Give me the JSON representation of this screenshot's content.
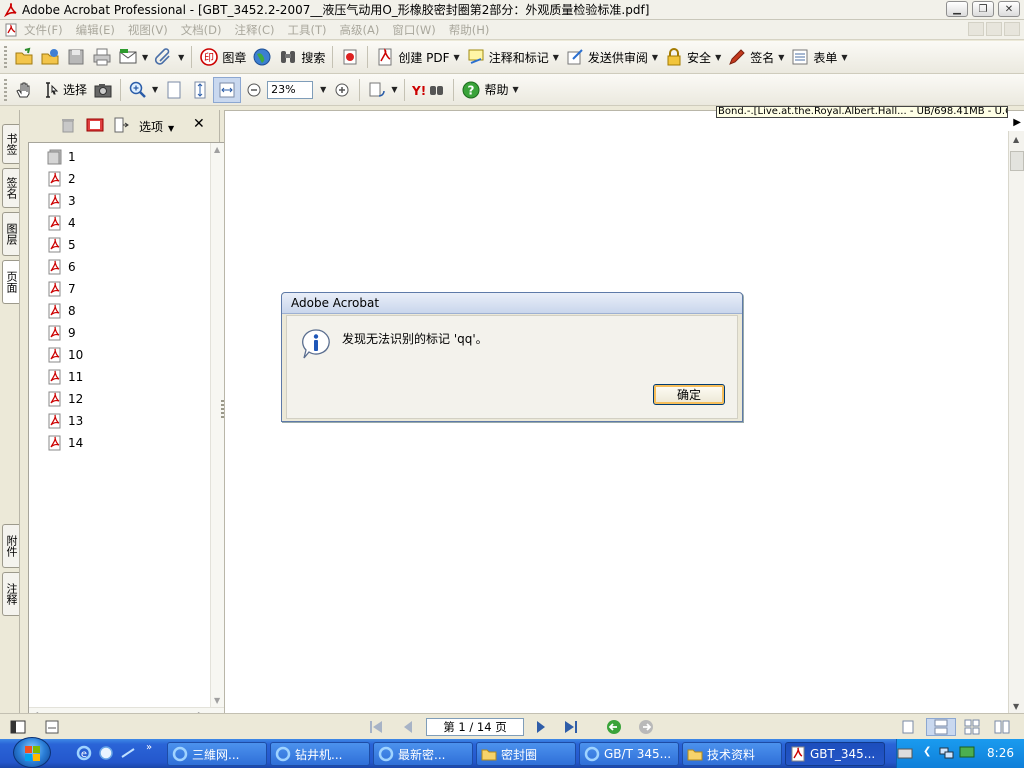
{
  "window": {
    "title": "Adobe Acrobat Professional - [GBT_3452.2-2007__液压气动用O_形橡胶密封圈第2部分：外观质量检验标准.pdf]"
  },
  "menu": {
    "items": [
      "文件(F)",
      "编辑(E)",
      "视图(V)",
      "文档(D)",
      "注释(C)",
      "工具(T)",
      "高级(A)",
      "窗口(W)",
      "帮助(H)"
    ]
  },
  "toolbar1": {
    "stamp_label": "图章",
    "search_label": "搜索",
    "create_pdf_label": "创建 PDF",
    "comment_label": "注释和标记",
    "review_label": "发送供审阅",
    "security_label": "安全",
    "sign_label": "签名",
    "forms_label": "表单"
  },
  "toolbar2": {
    "select_label": "选择",
    "zoom_value": "23%",
    "help_label": "帮助"
  },
  "nav_tabs": {
    "bookmarks": "书签",
    "signatures": "签名",
    "layers": "图层",
    "pages": "页面",
    "attachments": "附件",
    "comments": "注释"
  },
  "panel": {
    "options_label": "选项",
    "pages": [
      "1",
      "2",
      "3",
      "4",
      "5",
      "6",
      "7",
      "8",
      "9",
      "10",
      "11",
      "12",
      "13",
      "14"
    ]
  },
  "doc": {
    "tooltip": "Bond.-.[Live.at.the.Royal.Albert.Hall... - UB/698.41MB - U.C"
  },
  "dialog": {
    "title": "Adobe Acrobat",
    "message": "发现无法识别的标记 'qq'。",
    "ok_label": "确定"
  },
  "status": {
    "page_indicator": "第 1 / 14 页"
  },
  "taskbar": {
    "tasks": [
      "三維网...",
      "钻井机...",
      "最新密...",
      "密封圈",
      "GB/T 345...",
      "技术资料",
      "GBT_345..."
    ],
    "clock": "8:26"
  },
  "colors": {
    "taskbar_blue": "#2457cc",
    "dialog_ok_focus": "#f6be5b",
    "pdf_red": "#cc0000"
  }
}
